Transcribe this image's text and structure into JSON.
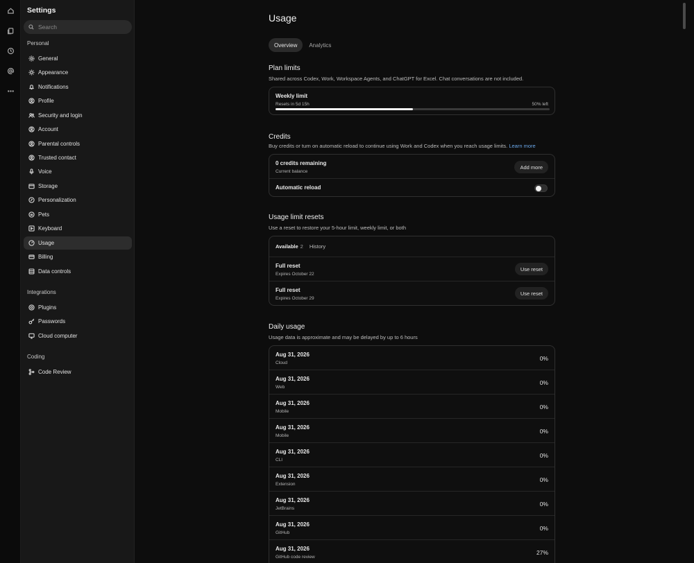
{
  "sidebar": {
    "title": "Settings",
    "search_placeholder": "Search",
    "sections": {
      "personal": "Personal",
      "integrations": "Integrations",
      "coding": "Coding"
    },
    "personal_items": [
      {
        "label": "General",
        "icon": "gear-icon"
      },
      {
        "label": "Appearance",
        "icon": "sun-icon"
      },
      {
        "label": "Notifications",
        "icon": "bell-icon"
      },
      {
        "label": "Profile",
        "icon": "user-circle-icon"
      },
      {
        "label": "Security and login",
        "icon": "people-icon"
      },
      {
        "label": "Account",
        "icon": "account-icon"
      },
      {
        "label": "Parental controls",
        "icon": "parental-icon"
      },
      {
        "label": "Trusted contact",
        "icon": "contact-icon"
      },
      {
        "label": "Voice",
        "icon": "mic-icon"
      },
      {
        "label": "Storage",
        "icon": "storage-icon"
      },
      {
        "label": "Personalization",
        "icon": "personalization-icon"
      },
      {
        "label": "Pets",
        "icon": "pets-icon"
      },
      {
        "label": "Keyboard",
        "icon": "keyboard-icon"
      },
      {
        "label": "Usage",
        "icon": "gauge-icon"
      },
      {
        "label": "Billing",
        "icon": "card-icon"
      },
      {
        "label": "Data controls",
        "icon": "database-icon"
      }
    ],
    "integration_items": [
      {
        "label": "Plugins",
        "icon": "plugin-icon"
      },
      {
        "label": "Passwords",
        "icon": "key-icon"
      },
      {
        "label": "Cloud computer",
        "icon": "computer-icon"
      }
    ],
    "coding_items": [
      {
        "label": "Code Review",
        "icon": "branch-icon"
      }
    ],
    "active": "Usage"
  },
  "main": {
    "title": "Usage",
    "tabs": [
      {
        "label": "Overview",
        "active": true
      },
      {
        "label": "Analytics",
        "active": false
      }
    ],
    "plan_limits": {
      "title": "Plan limits",
      "description": "Shared across Codex, Work, Workspace Agents, and ChatGPT for Excel. Chat conversations are not included.",
      "weekly": {
        "title": "Weekly limit",
        "resets": "Resets in 5d 15h",
        "left": "50% left",
        "used_fraction": 0.5
      }
    },
    "credits": {
      "title": "Credits",
      "description": "Buy credits or turn on automatic reload to continue using Work and Codex when you reach usage limits.",
      "learn_more": "Learn more",
      "remaining": "0 credits remaining",
      "balance_label": "Current balance",
      "add_more": "Add more",
      "auto_reload": "Automatic reload",
      "auto_reload_on": false
    },
    "resets": {
      "title": "Usage limit resets",
      "description": "Use a reset to restore your 5-hour limit, weekly limit, or both",
      "tab_available": "Available",
      "available_count": "2",
      "tab_history": "History",
      "items": [
        {
          "title": "Full reset",
          "expires": "Expires October 22",
          "button": "Use reset"
        },
        {
          "title": "Full reset",
          "expires": "Expires October 29",
          "button": "Use reset"
        }
      ]
    },
    "daily": {
      "title": "Daily usage",
      "description": "Usage data is approximate and may be delayed by up to 6 hours",
      "rows": [
        {
          "date": "Aug 31, 2026",
          "source": "Cloud",
          "pct": "0%"
        },
        {
          "date": "Aug 31, 2026",
          "source": "Web",
          "pct": "0%"
        },
        {
          "date": "Aug 31, 2026",
          "source": "Mobile",
          "pct": "0%"
        },
        {
          "date": "Aug 31, 2026",
          "source": "Mobile",
          "pct": "0%"
        },
        {
          "date": "Aug 31, 2026",
          "source": "CLI",
          "pct": "0%"
        },
        {
          "date": "Aug 31, 2026",
          "source": "Extension",
          "pct": "0%"
        },
        {
          "date": "Aug 31, 2026",
          "source": "JetBrains",
          "pct": "0%"
        },
        {
          "date": "Aug 31, 2026",
          "source": "GitHub",
          "pct": "0%"
        },
        {
          "date": "Aug 31, 2026",
          "source": "GitHub code review",
          "pct": "27%"
        }
      ]
    }
  }
}
